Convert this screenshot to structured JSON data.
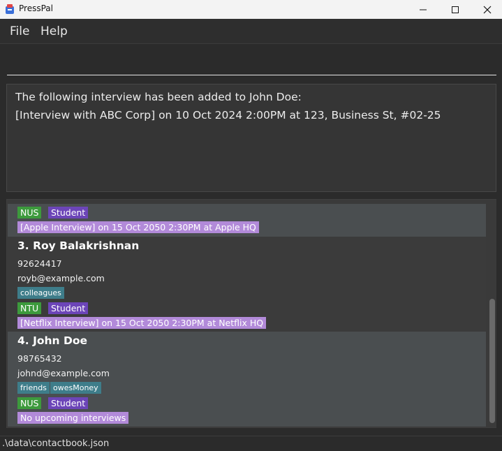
{
  "window": {
    "title": "PressPal",
    "minimize": "—",
    "maximize": "☐",
    "close": "✕"
  },
  "menu": {
    "file": "File",
    "help": "Help"
  },
  "command": {
    "value": ""
  },
  "result": {
    "line1": "The following interview has been added to John Doe:",
    "line2": "[Interview with ABC Corp] on 10 Oct 2024 2:00PM at 123, Business St, #02-25"
  },
  "contacts": {
    "partial": {
      "tags": [
        "NUS",
        "Student"
      ],
      "interview": "[Apple Interview] on 15 Oct 2050 2:30PM at Apple HQ"
    },
    "roy": {
      "name": "3. Roy Balakrishnan",
      "phone": "92624417",
      "email": "royb@example.com",
      "labels": [
        "colleagues"
      ],
      "tags": [
        "NTU",
        "Student"
      ],
      "interview": "[Netflix Interview] on 15 Oct 2050 2:30PM at Netflix HQ"
    },
    "john": {
      "name": "4. John Doe",
      "phone": "98765432",
      "email": "johnd@example.com",
      "labels": [
        "friends",
        "owesMoney"
      ],
      "tags": [
        "NUS",
        "Student"
      ],
      "interview": "No upcoming interviews"
    }
  },
  "status": {
    "path": ".\\data\\contactbook.json"
  },
  "colors": {
    "tag_green": "#3d9a3d",
    "tag_purple": "#6c45b8",
    "tag_teal": "#3e7d8a",
    "tag_interview": "#b28ad9"
  }
}
